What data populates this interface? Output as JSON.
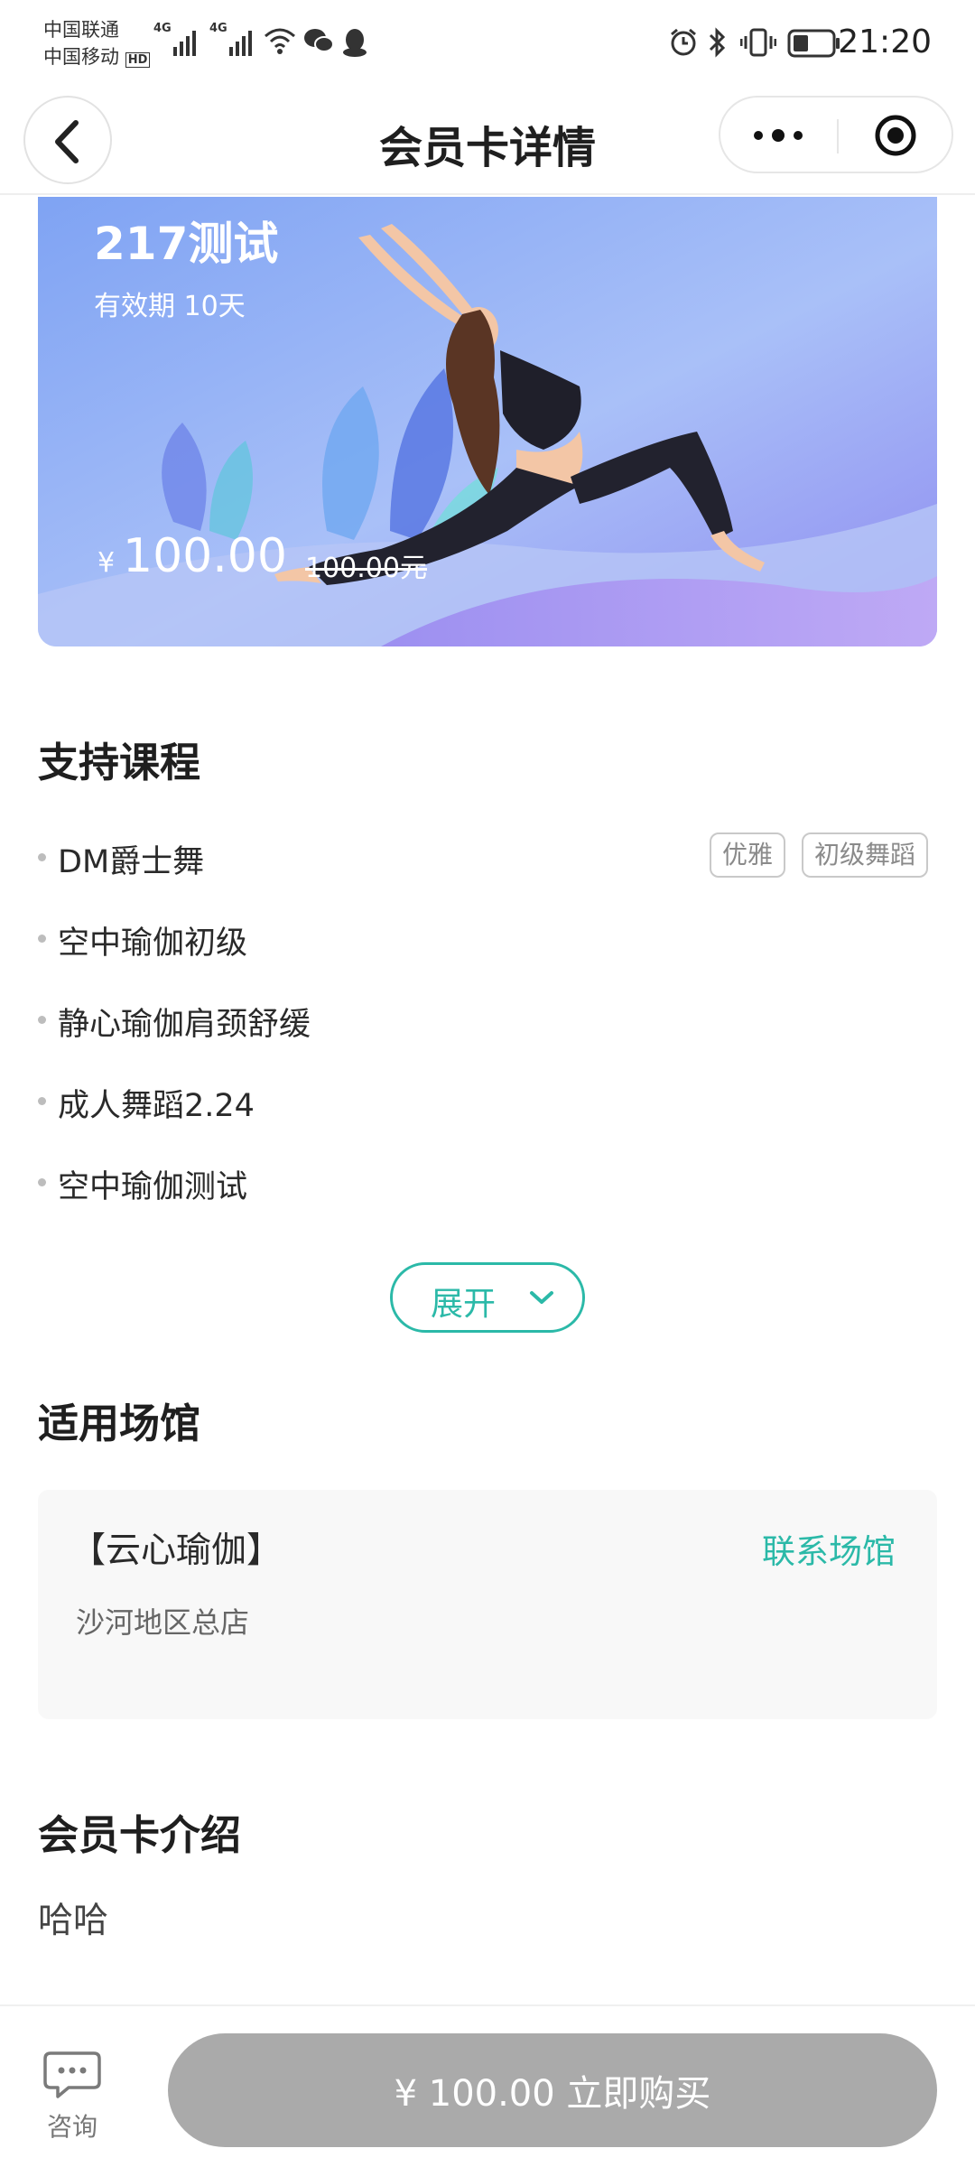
{
  "status_bar": {
    "carrier_1": "中国联通",
    "carrier_2": "中国移动",
    "hd_badge": "HD",
    "network_1": "4G",
    "network_2": "4G",
    "time": "21:20",
    "icons": [
      "alarm-icon",
      "bluetooth-icon",
      "vibrate-icon",
      "battery-icon"
    ]
  },
  "nav": {
    "title": "会员卡详情",
    "back_icon": "chevron-left-icon",
    "more_icon": "more-dots-icon",
    "close_icon": "target-icon"
  },
  "card": {
    "name": "217测试",
    "validity": "有效期 10天",
    "currency": "¥",
    "price": "100.00",
    "original_price": "100.00元",
    "colors": {
      "bg_top": "#8fb0f5",
      "bg_bottom": "#a9a0f0"
    }
  },
  "courses": {
    "title": "支持课程",
    "items": [
      {
        "name": "DM爵士舞",
        "tags": [
          "优雅",
          "初级舞蹈"
        ]
      },
      {
        "name": "空中瑜伽初级",
        "tags": []
      },
      {
        "name": "静心瑜伽肩颈舒缓",
        "tags": []
      },
      {
        "name": "成人舞蹈2.24",
        "tags": []
      },
      {
        "name": "空中瑜伽测试",
        "tags": []
      }
    ],
    "expand_label": "展开"
  },
  "venue": {
    "title": "适用场馆",
    "name": "【云心瑜伽】",
    "contact_label": "联系场馆",
    "address": "沙河地区总店"
  },
  "intro": {
    "title": "会员卡介绍",
    "text": "哈哈"
  },
  "bottom_bar": {
    "consult_label": "咨询",
    "buy_label": "¥ 100.00 立即购买"
  },
  "colors": {
    "accent": "#2bb9a8",
    "buy_button_disabled": "#aaaaaa"
  }
}
